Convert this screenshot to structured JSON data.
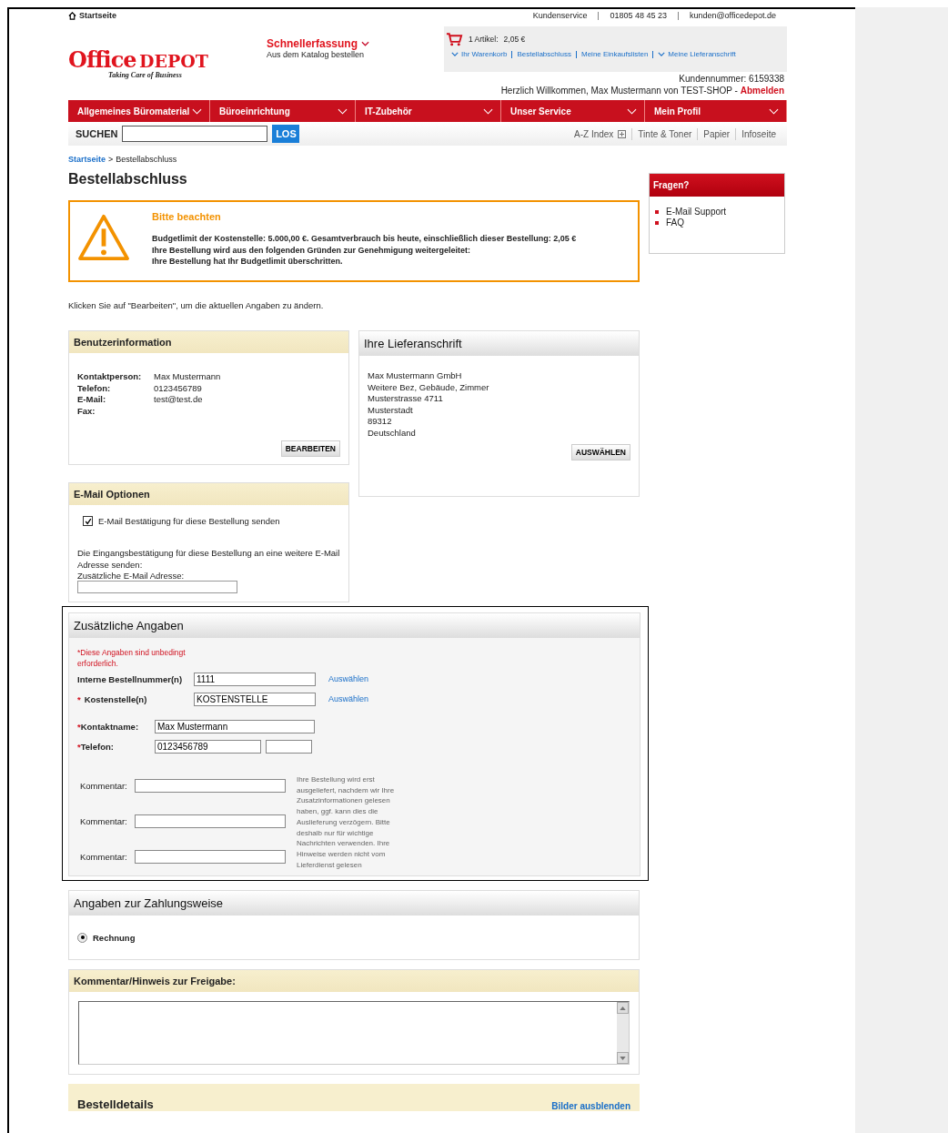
{
  "topbar": {
    "home": "Startseite",
    "links": [
      "Kundenservice",
      "01805 48 45 23",
      "kunden@officedepot.de"
    ]
  },
  "logo": {
    "word1": "Office",
    "word2": "DEPOT",
    "tagline": "Taking Care of Business"
  },
  "quick_order": {
    "title": "Schnellerfassung",
    "subtitle": "Aus dem Katalog bestellen"
  },
  "cart": {
    "label": "1 Artikel:",
    "amount": "2,05 €",
    "links": [
      {
        "label": "Ihr Warenkorb",
        "caret": true
      },
      {
        "label": "Bestellabschluss",
        "caret": false
      },
      {
        "label": "Meine Einkaufslisten",
        "caret": false
      },
      {
        "label": "Meine Lieferanschrift",
        "caret": true
      }
    ]
  },
  "account": {
    "customer_number": "Kundennummer:  6159338",
    "welcome": "Herzlich Willkommen, Max Mustermann von TEST-SHOP  -",
    "logout": "Abmelden"
  },
  "nav": [
    "Allgemeines Büromaterial",
    "Büroeinrichtung",
    "IT-Zubehör",
    "Unser Service",
    "Mein Profil"
  ],
  "search": {
    "label": "SUCHEN",
    "button": "LOS",
    "links": [
      {
        "label": "A-Z Index",
        "plus": true
      },
      {
        "label": "Tinte & Toner",
        "plus": false
      },
      {
        "label": "Papier",
        "plus": false
      },
      {
        "label": "Infoseite",
        "plus": false
      }
    ]
  },
  "breadcrumb": {
    "link": "Startseite",
    "separator": ">",
    "current": "Bestellabschluss"
  },
  "title": "Bestellabschluss",
  "notice": {
    "title": "Bitte beachten",
    "lines": [
      "Budgetlimit der Kostenstelle: 5.000,00 €. Gesamtverbrauch bis heute, einschließlich dieser Bestellung: 2,05 €",
      "Ihre Bestellung wird aus den folgenden Gründen zur Genehmigung weitergeleitet:",
      "Ihre Bestellung hat Ihr Budgetlimit überschritten."
    ]
  },
  "intro": "Klicken Sie auf \"Bearbeiten\", um die aktuellen Angaben zu ändern.",
  "user_info": {
    "title": "Benutzerinformation",
    "rows": [
      {
        "label": "Kontaktperson:",
        "value": "Max Mustermann"
      },
      {
        "label": "Telefon:",
        "value": "0123456789"
      },
      {
        "label": "E-Mail:",
        "value": "test@test.de"
      },
      {
        "label": "Fax:"
      }
    ],
    "button": "BEARBEITEN"
  },
  "email_options": {
    "title": "E-Mail Optionen",
    "checkbox": {
      "label": "E-Mail Bestätigung für diese Bestellung senden",
      "checked": true
    },
    "text": "Die Eingangsbestätigung für diese Bestellung an eine weitere E-Mail Adresse senden:",
    "field_label": "Zusätzliche E-Mail Adresse:"
  },
  "delivery": {
    "title": "Ihre Lieferanschrift",
    "lines": [
      "Max Mustermann GmbH",
      "Weitere Bez, Gebäude, Zimmer",
      "Musterstrasse 4711",
      "Musterstadt",
      "89312",
      "Deutschland"
    ],
    "button": "AUSWÄHLEN"
  },
  "additional": {
    "title": "Zusätzliche Angaben",
    "required_note": "*Diese Angaben sind unbedingt erforderlich.",
    "fields": [
      {
        "label": "Interne Bestellnummer(n)",
        "value": "1111",
        "link": "Auswählen"
      },
      {
        "label": "Kostenstelle(n)",
        "marker": "*",
        "value": "KOSTENSTELLE",
        "link": "Auswählen"
      }
    ],
    "contact": [
      {
        "label": "Kontaktname:",
        "marker": "*",
        "value": "Max Mustermann"
      },
      {
        "label": "Telefon:",
        "marker": "*",
        "value": "0123456789"
      }
    ],
    "comments": [
      "Kommentar:",
      "Kommentar:",
      "Kommentar:"
    ],
    "hint": "Ihre Bestellung wird erst ausgeliefert, nachdem wir Ihre Zusatzinformationen gelesen haben, ggf. kann dies die Auslieferung verzögern. Bitte deshalb nur für wichtige Nachrichten verwenden. Ihre Hinweise werden nicht vom Lieferdienst gelesen"
  },
  "payment": {
    "title": "Angaben zur Zahlungsweise",
    "options": [
      {
        "label": "Rechnung",
        "selected": true
      }
    ]
  },
  "approval": {
    "title": "Kommentar/Hinweis zur Freigabe:"
  },
  "details": {
    "title": "Bestelldetails",
    "link": "Bilder ausblenden"
  },
  "sidebar": {
    "title": "Fragen?",
    "links": [
      "E-Mail Support",
      "FAQ"
    ]
  }
}
